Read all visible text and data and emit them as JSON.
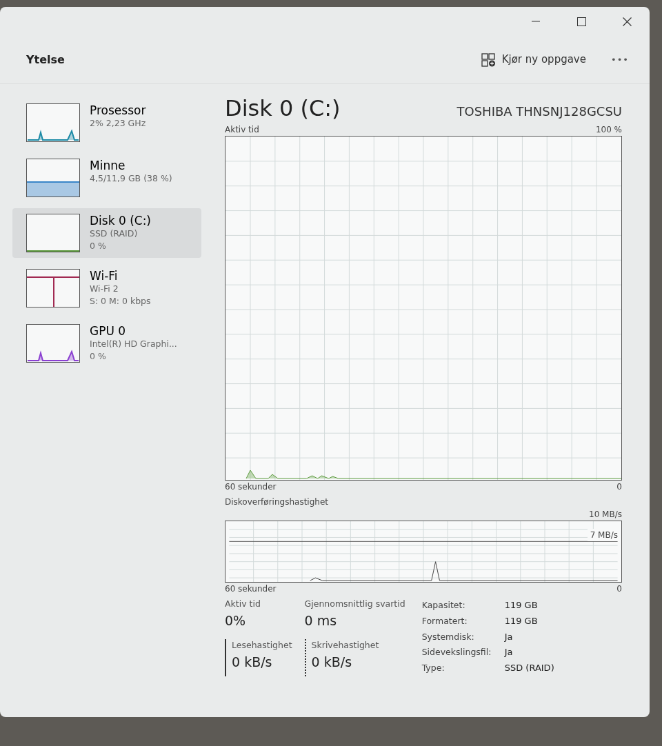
{
  "header": {
    "title": "Ytelse",
    "run_task": "Kjør ny oppgave",
    "more": "•••"
  },
  "sidebar": {
    "items": [
      {
        "name": "Prosessor",
        "lines": [
          "2% 2,23 GHz"
        ],
        "selected": false,
        "kind": "spikes",
        "color": "#1b8aa6"
      },
      {
        "name": "Minne",
        "lines": [
          "4,5/11,9 GB (38 %)"
        ],
        "selected": false,
        "kind": "fill",
        "color": "#3a86c8"
      },
      {
        "name": "Disk 0 (C:)",
        "lines": [
          "SSD (RAID)",
          "0 %"
        ],
        "selected": true,
        "kind": "empty",
        "color": "#5c9a3c"
      },
      {
        "name": "Wi-Fi",
        "lines": [
          "Wi-Fi 2",
          "S: 0 M: 0 kbps"
        ],
        "selected": false,
        "kind": "step",
        "color": "#a12a52"
      },
      {
        "name": "GPU 0",
        "lines": [
          "Intel(R) HD Graphi...",
          "0 %"
        ],
        "selected": false,
        "kind": "spikes",
        "color": "#8a3fd1"
      }
    ]
  },
  "main": {
    "title": "Disk 0 (C:)",
    "model": "TOSHIBA THNSNJ128GCSU",
    "activity_graph": {
      "label": "Aktiv tid",
      "max": "100 %",
      "time": "60 sekunder",
      "min": "0"
    },
    "transfer_graph": {
      "label": "Diskoverføringshastighet",
      "max": "10 MB/s",
      "mid": "7 MB/s",
      "time": "60 sekunder",
      "min": "0"
    },
    "stats": [
      {
        "kind": "plain",
        "label": "Aktiv tid",
        "value": "0%"
      },
      {
        "kind": "plain",
        "label": "Gjennomsnittlig svartid",
        "value": "0 ms"
      },
      {
        "kind": "solid",
        "label": "Lesehastighet",
        "value": "0 kB/s"
      },
      {
        "kind": "dotted",
        "label": "Skrivehastighet",
        "value": "0 kB/s"
      }
    ],
    "properties": [
      {
        "key": "Kapasitet:",
        "value": "119 GB"
      },
      {
        "key": "Formatert:",
        "value": "119 GB"
      },
      {
        "key": "Systemdisk:",
        "value": "Ja"
      },
      {
        "key": "Sidevekslingsfil:",
        "value": "Ja"
      },
      {
        "key": "Type:",
        "value": "SSD (RAID)"
      }
    ]
  }
}
